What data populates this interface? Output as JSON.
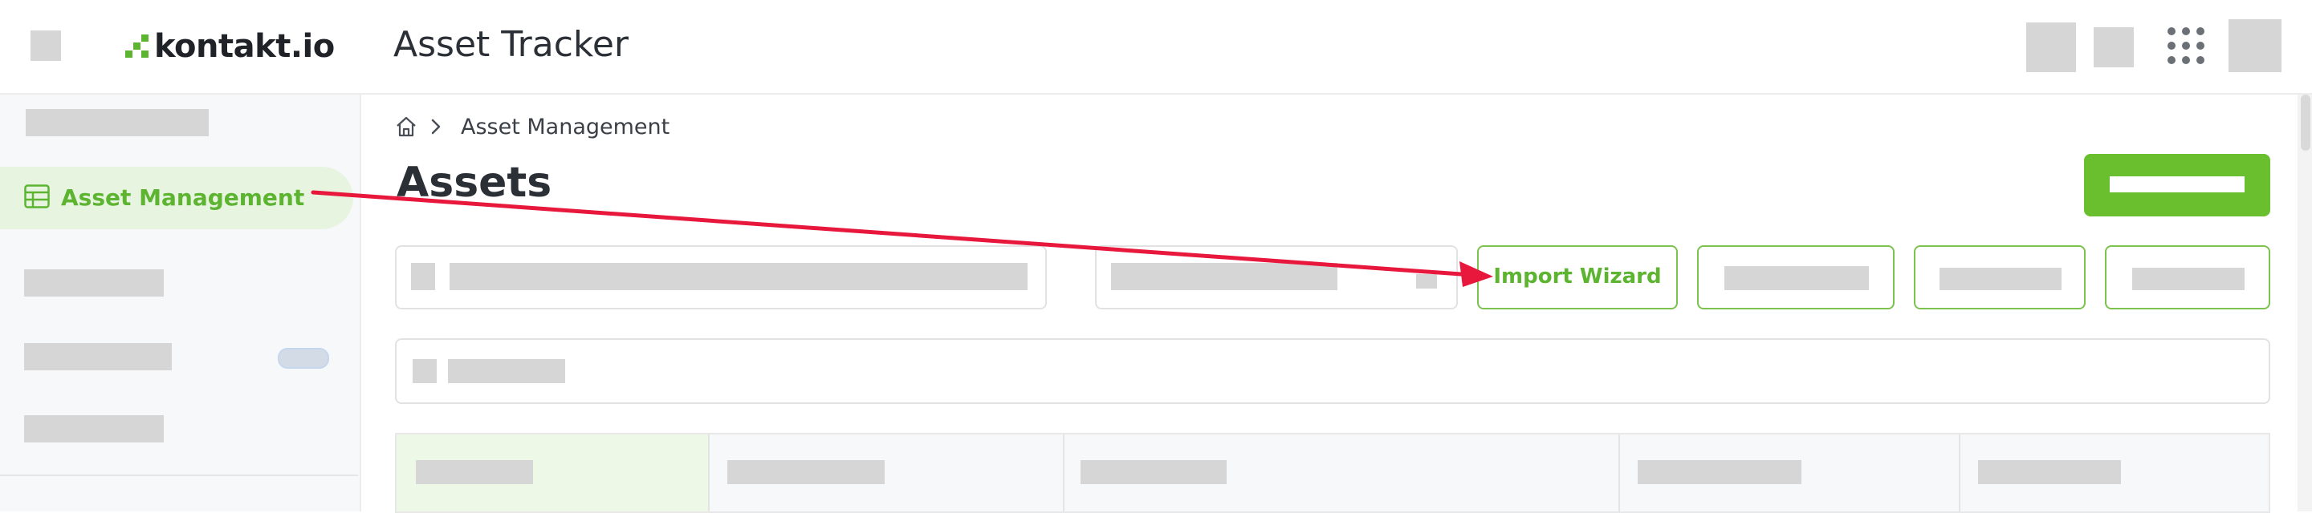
{
  "header": {
    "brand": "kontakt.io",
    "app_title": "Asset Tracker"
  },
  "sidebar": {
    "active_item": "Asset Management"
  },
  "breadcrumb": {
    "current": "Asset Management"
  },
  "main": {
    "page_title": "Assets",
    "import_wizard_label": "Import Wizard"
  },
  "colors": {
    "accent_green": "#5cb431",
    "annotation_arrow": "#e8173c"
  },
  "icons": [
    "menu-icon",
    "home-icon",
    "chevron-right-icon",
    "table-icon",
    "apps-grid-icon"
  ]
}
